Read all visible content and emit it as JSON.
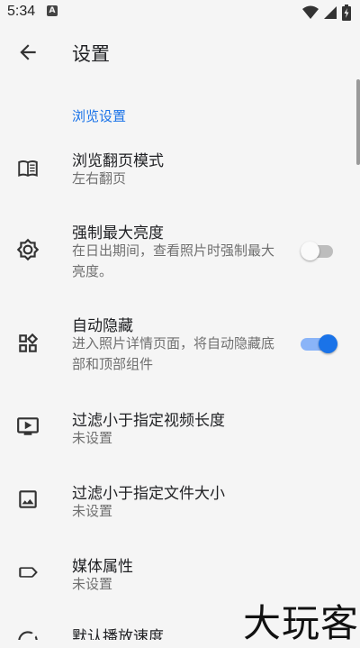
{
  "status_bar": {
    "time": "5:34",
    "notification_glyph": "A",
    "icons": [
      "wifi-icon",
      "signal-icon",
      "battery-icon"
    ]
  },
  "app_bar": {
    "title": "设置"
  },
  "section": {
    "header": "浏览设置"
  },
  "items": [
    {
      "title": "浏览翻页模式",
      "subtitle": "左右翻页",
      "icon": "book-icon"
    },
    {
      "title": "强制最大亮度",
      "subtitle": "在日出期间，查看照片时强制最大亮度。",
      "icon": "brightness-icon",
      "switch": false
    },
    {
      "title": "自动隐藏",
      "subtitle": "进入照片详情页面，将自动隐藏底部和顶部组件",
      "icon": "widgets-icon",
      "switch": true
    },
    {
      "title": "过滤小于指定视频长度",
      "subtitle": "未设置",
      "icon": "video-icon"
    },
    {
      "title": "过滤小于指定文件大小",
      "subtitle": "未设置",
      "icon": "image-icon"
    },
    {
      "title": "媒体属性",
      "subtitle": "未设置",
      "icon": "label-icon"
    },
    {
      "title": "默认播放速度",
      "icon": "speed-icon"
    }
  ],
  "colors": {
    "accent": "#1a73e8",
    "background": "#f5f5f5"
  },
  "watermark": "大玩客"
}
